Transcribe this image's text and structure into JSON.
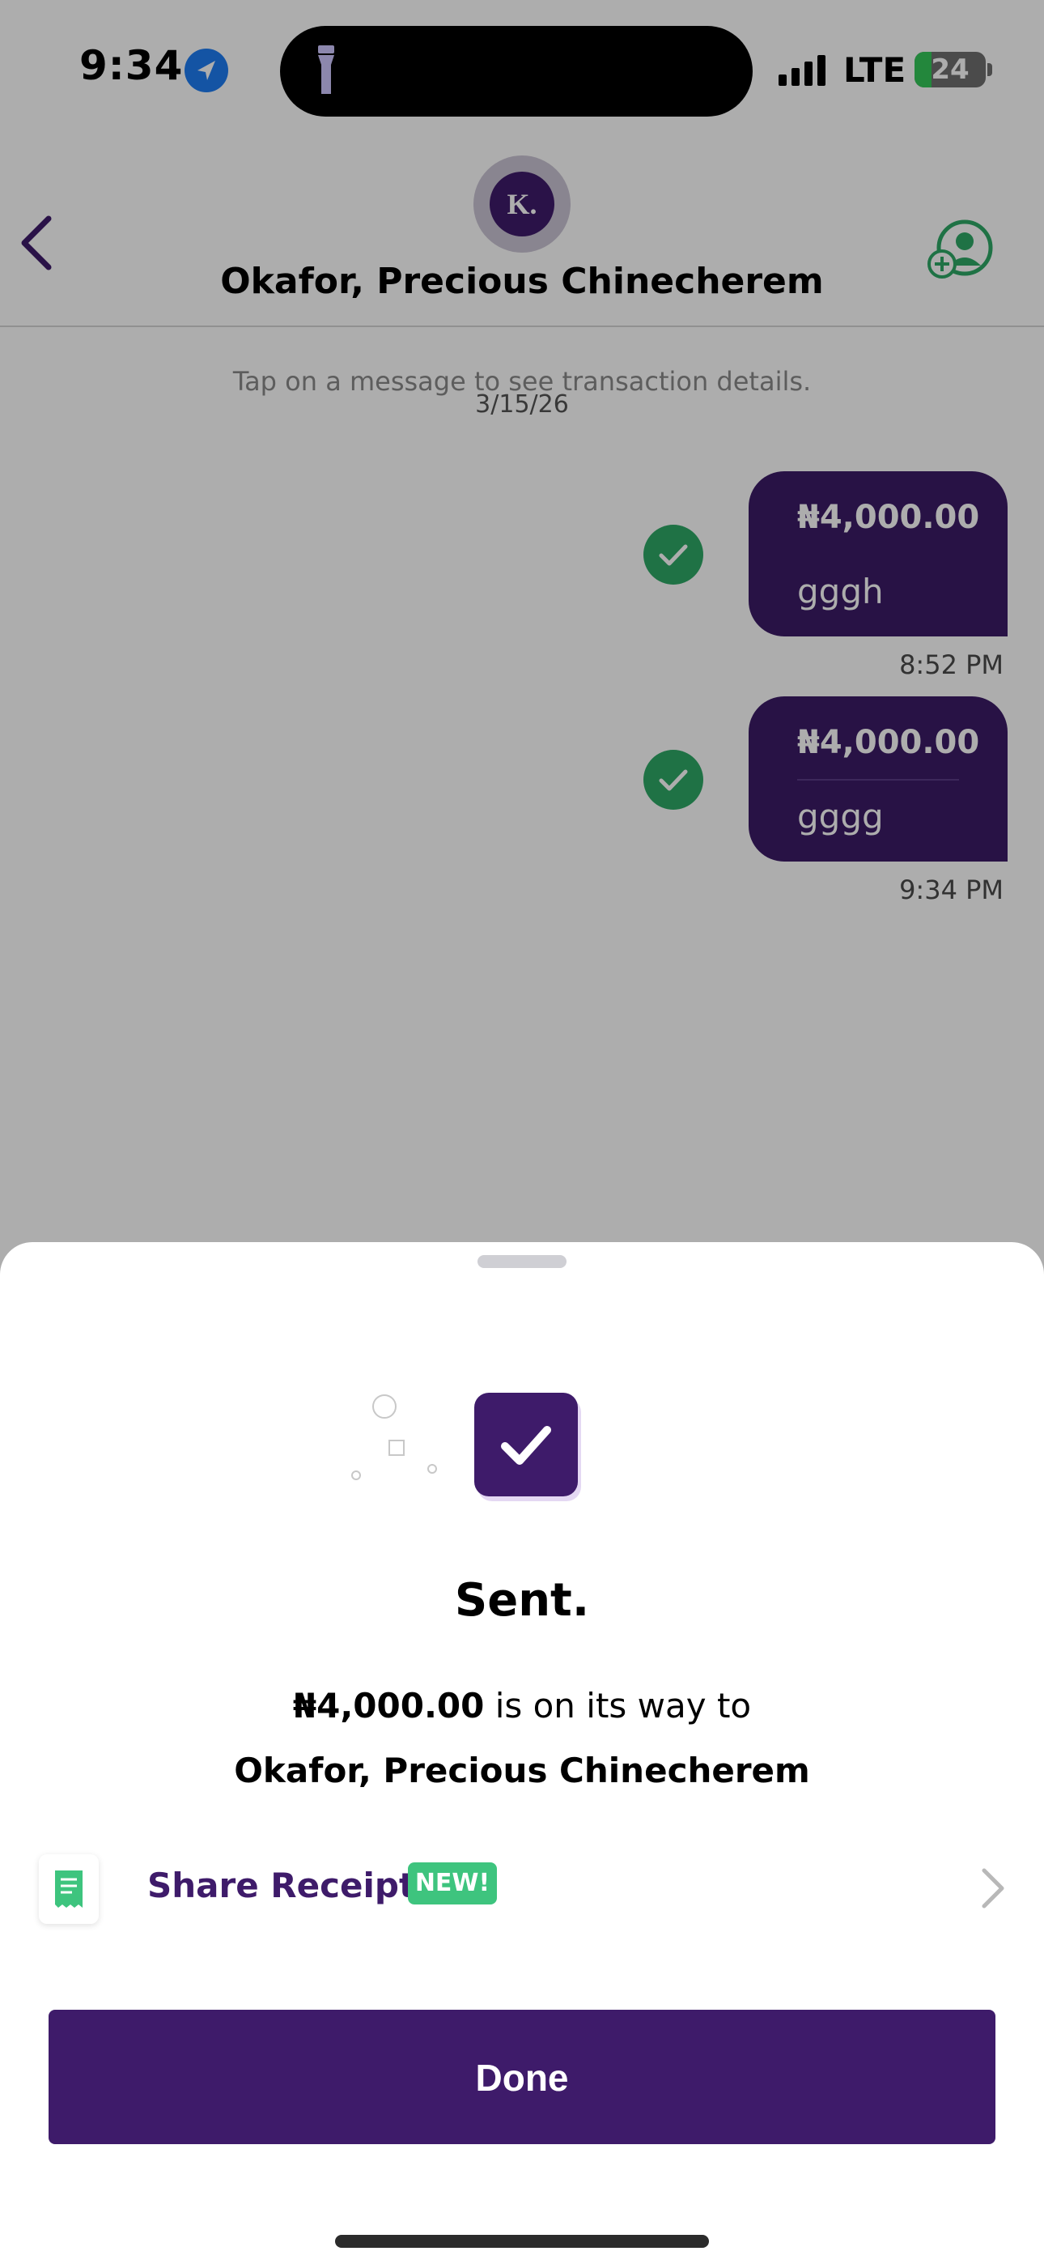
{
  "status_bar": {
    "time": "9:34",
    "network": "LTE",
    "battery": "24",
    "battery_level": 0.24,
    "icons": [
      "location-icon",
      "flashlight-icon",
      "signal-icon",
      "battery-icon"
    ]
  },
  "chat": {
    "contact_name": "Okafor, Precious Chinecherem",
    "avatar_initial": "K.",
    "hint": "Tap on a message to see transaction details.",
    "date": "3/15/26",
    "messages": [
      {
        "amount": "₦4,000.00",
        "note": "gggh",
        "time": "8:52 PM",
        "status": "check-icon"
      },
      {
        "amount": "₦4,000.00",
        "note": "gggg",
        "time": "9:34 PM",
        "status": "check-icon"
      }
    ]
  },
  "sheet": {
    "title": "Sent.",
    "amount": "₦4,000.00",
    "message_suffix": " is on its way to",
    "recipient": "Okafor, Precious Chinecherem",
    "share_receipt_label": "Share Receipt",
    "new_badge": "NEW!",
    "done_label": "Done"
  },
  "colors": {
    "brand_purple": "#3e1b6a",
    "success_green": "#2ea866",
    "badge_green": "#3ec47e"
  }
}
